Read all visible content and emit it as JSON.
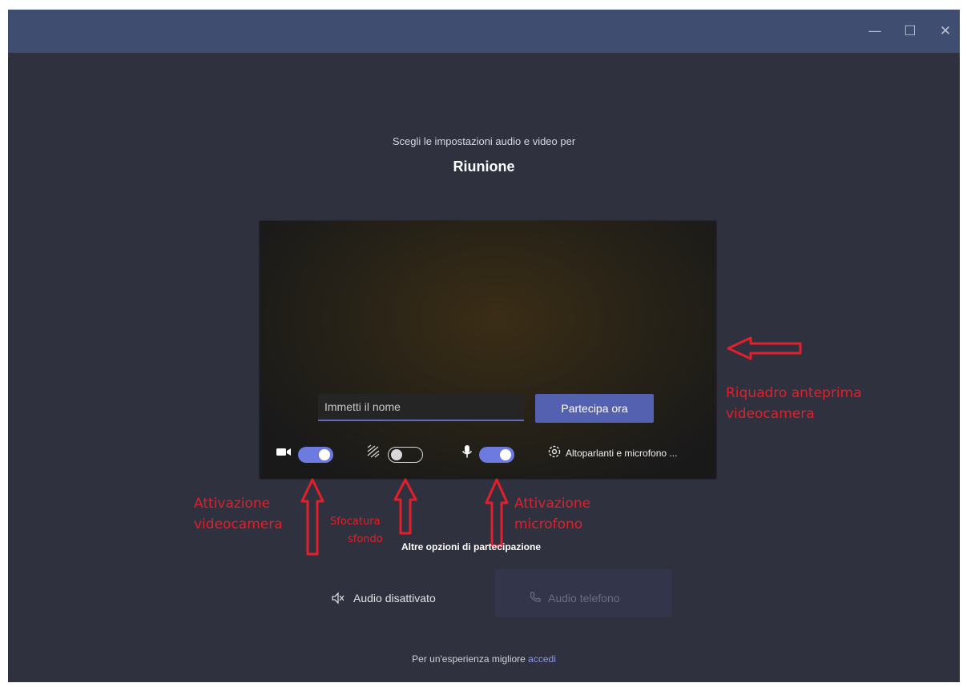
{
  "window": {
    "controls": {
      "minimize": "—",
      "maximize": "☐",
      "close": "✕"
    }
  },
  "header": {
    "subtitle": "Scegli le impostazioni audio e video per",
    "title": "Riunione"
  },
  "preview": {
    "name_placeholder": "Immetti il nome",
    "join_label": "Partecipa ora",
    "controls": {
      "camera": {
        "icon": "camera-icon",
        "on": true
      },
      "blur": {
        "icon": "background-blur-icon",
        "on": false
      },
      "microphone": {
        "icon": "microphone-icon",
        "on": true
      },
      "devices": {
        "icon": "gear-icon",
        "label": "Altoparlanti e microfono ..."
      }
    }
  },
  "annotations": {
    "preview": [
      "Riquadro anteprima",
      "videocamera"
    ],
    "camera": [
      "Attivazione",
      "videocamera"
    ],
    "blur": [
      "Sfocatura",
      "sfondo"
    ],
    "microphone": [
      "Attivazione",
      "microfono"
    ],
    "color": "#e0202a"
  },
  "more_options": {
    "title": "Altre opzioni di partecipazione",
    "audio_off": {
      "icon": "speaker-off-icon",
      "label": "Audio disattivato"
    },
    "phone_audio": {
      "icon": "phone-icon",
      "label": "Audio telefono"
    }
  },
  "footer": {
    "text": "Per un'esperienza migliore ",
    "link": "accedi"
  },
  "colors": {
    "window_background": "#30313f",
    "titlebar": "#3f4d71",
    "accent": "#5361b0",
    "toggle_on": "#6d7ae0"
  }
}
